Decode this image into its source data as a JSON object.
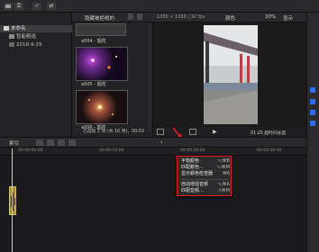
{
  "toolbar": {
    "check_label": "✓",
    "key_label": "⚿",
    "switch_label": "⇄"
  },
  "library": {
    "items": [
      {
        "label": "未命名"
      },
      {
        "label": "智能精选"
      },
      {
        "label": "2018-9-29"
      }
    ]
  },
  "browser": {
    "filter_label": "隐藏被拒绝的",
    "clips": [
      {
        "caption": "a004 - 烟花"
      },
      {
        "caption": "a005 - 烟花"
      },
      {
        "caption": "a006 - 烟花"
      }
    ],
    "status": "已选取 1 项 (共 16 项)，00:03"
  },
  "viewer": {
    "format": "1080 × 1080 | 30 fps",
    "effect_label": "颜色",
    "zoom": "30%",
    "view_label": "显示",
    "timecode": "01:25 超时间长度"
  },
  "timeline": {
    "index_label": "索引",
    "ruler": [
      "00:00:00:00",
      "00:00:10:00",
      "00:00:20:00",
      "00:00:30:00"
    ]
  },
  "menu": {
    "items": [
      {
        "label": "平衡颜色",
        "shortcut": "⌥⌘B"
      },
      {
        "label": "匹配颜色...",
        "shortcut": "⌥⌘M"
      },
      {
        "label": "显示颜色检查器",
        "shortcut": "⌘6"
      },
      {
        "label": "自动增强音频",
        "shortcut": "⌥⌘A"
      },
      {
        "label": "匹配音频...",
        "shortcut": "⇧⌘M"
      }
    ]
  },
  "colors": {
    "accent": "#2f6ef0",
    "highlight_red": "#e02020"
  }
}
